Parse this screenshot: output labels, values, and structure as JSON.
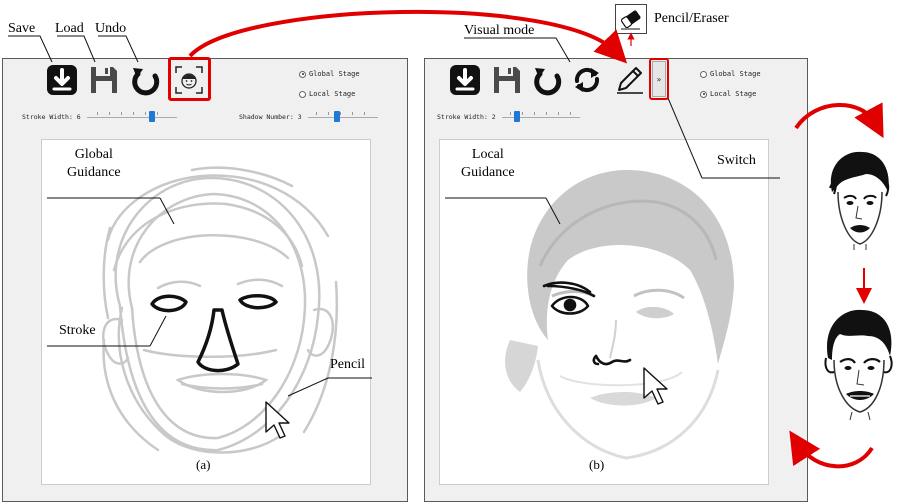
{
  "top_labels": {
    "save": "Save",
    "load": "Load",
    "undo": "Undo",
    "visual_mode": "Visual mode",
    "pencil_eraser": "Pencil/Eraser"
  },
  "panel_a": {
    "radio_options": [
      {
        "label": "Global Stage",
        "selected": true
      },
      {
        "label": "Local Stage",
        "selected": false
      }
    ],
    "stroke_width_label": "Stroke Width: 6",
    "stroke_width_value": 6,
    "shadow_number_label": "Shadow Number: 3",
    "shadow_number_value": 3,
    "callouts": {
      "global_guidance": "Global\nGuidance",
      "stroke": "Stroke",
      "pencil": "Pencil"
    },
    "caption": "(a)"
  },
  "panel_b": {
    "radio_options": [
      {
        "label": "Global Stage",
        "selected": false
      },
      {
        "label": "Local Stage",
        "selected": true
      }
    ],
    "stroke_width_label": "Stroke Width: 2",
    "stroke_width_value": 2,
    "switch_button_label": "»",
    "callouts": {
      "local_guidance": "Local\nGuidance",
      "switch": "Switch"
    },
    "caption": "(b)"
  },
  "colors": {
    "highlight": "#e00000",
    "slider_thumb": "#1e78d6",
    "panel_bg": "#f0f0f0"
  },
  "icons": [
    "save-icon",
    "load-icon",
    "undo-icon",
    "face-mode-icon",
    "redo-icon",
    "pencil-icon",
    "eraser-icon",
    "cursor-arrow-icon"
  ]
}
